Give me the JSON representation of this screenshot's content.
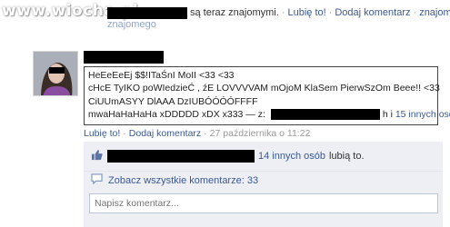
{
  "watermark": "www.wiocha.pl",
  "top": {
    "text": "są teraz znajomymi.",
    "like_link": "Lubię to!",
    "comment_link": "Dodaj komentarz",
    "subline": "znajomego"
  },
  "post": {
    "lines": [
      "HeEeEeEj $$!ITaŚnI MoII <33 <33",
      "cHcE TyIKO poWIedzieĆ , źE LOVVVVAM mOjoM KlaSem PierwSzOm Beee!! <33",
      "CiUUmASYY DlAAA DzIUBÓÓÓÓFFFF"
    ],
    "last_line_start": "mwaHaHaHaHa xDDDDD xDX x333 — z:",
    "last_line_end": "h i",
    "others_link": "15 innych osób.",
    "meta": {
      "like": "Lubię to!",
      "comment": "Dodaj komentarz",
      "date": "27 października o 11:22"
    }
  },
  "comments": {
    "likes_link": "14 innych osób",
    "likes_suffix": "lubią to.",
    "view_all": "Zobacz wszystkie komentarze: 33",
    "placeholder": "Napisz komentarz..."
  }
}
